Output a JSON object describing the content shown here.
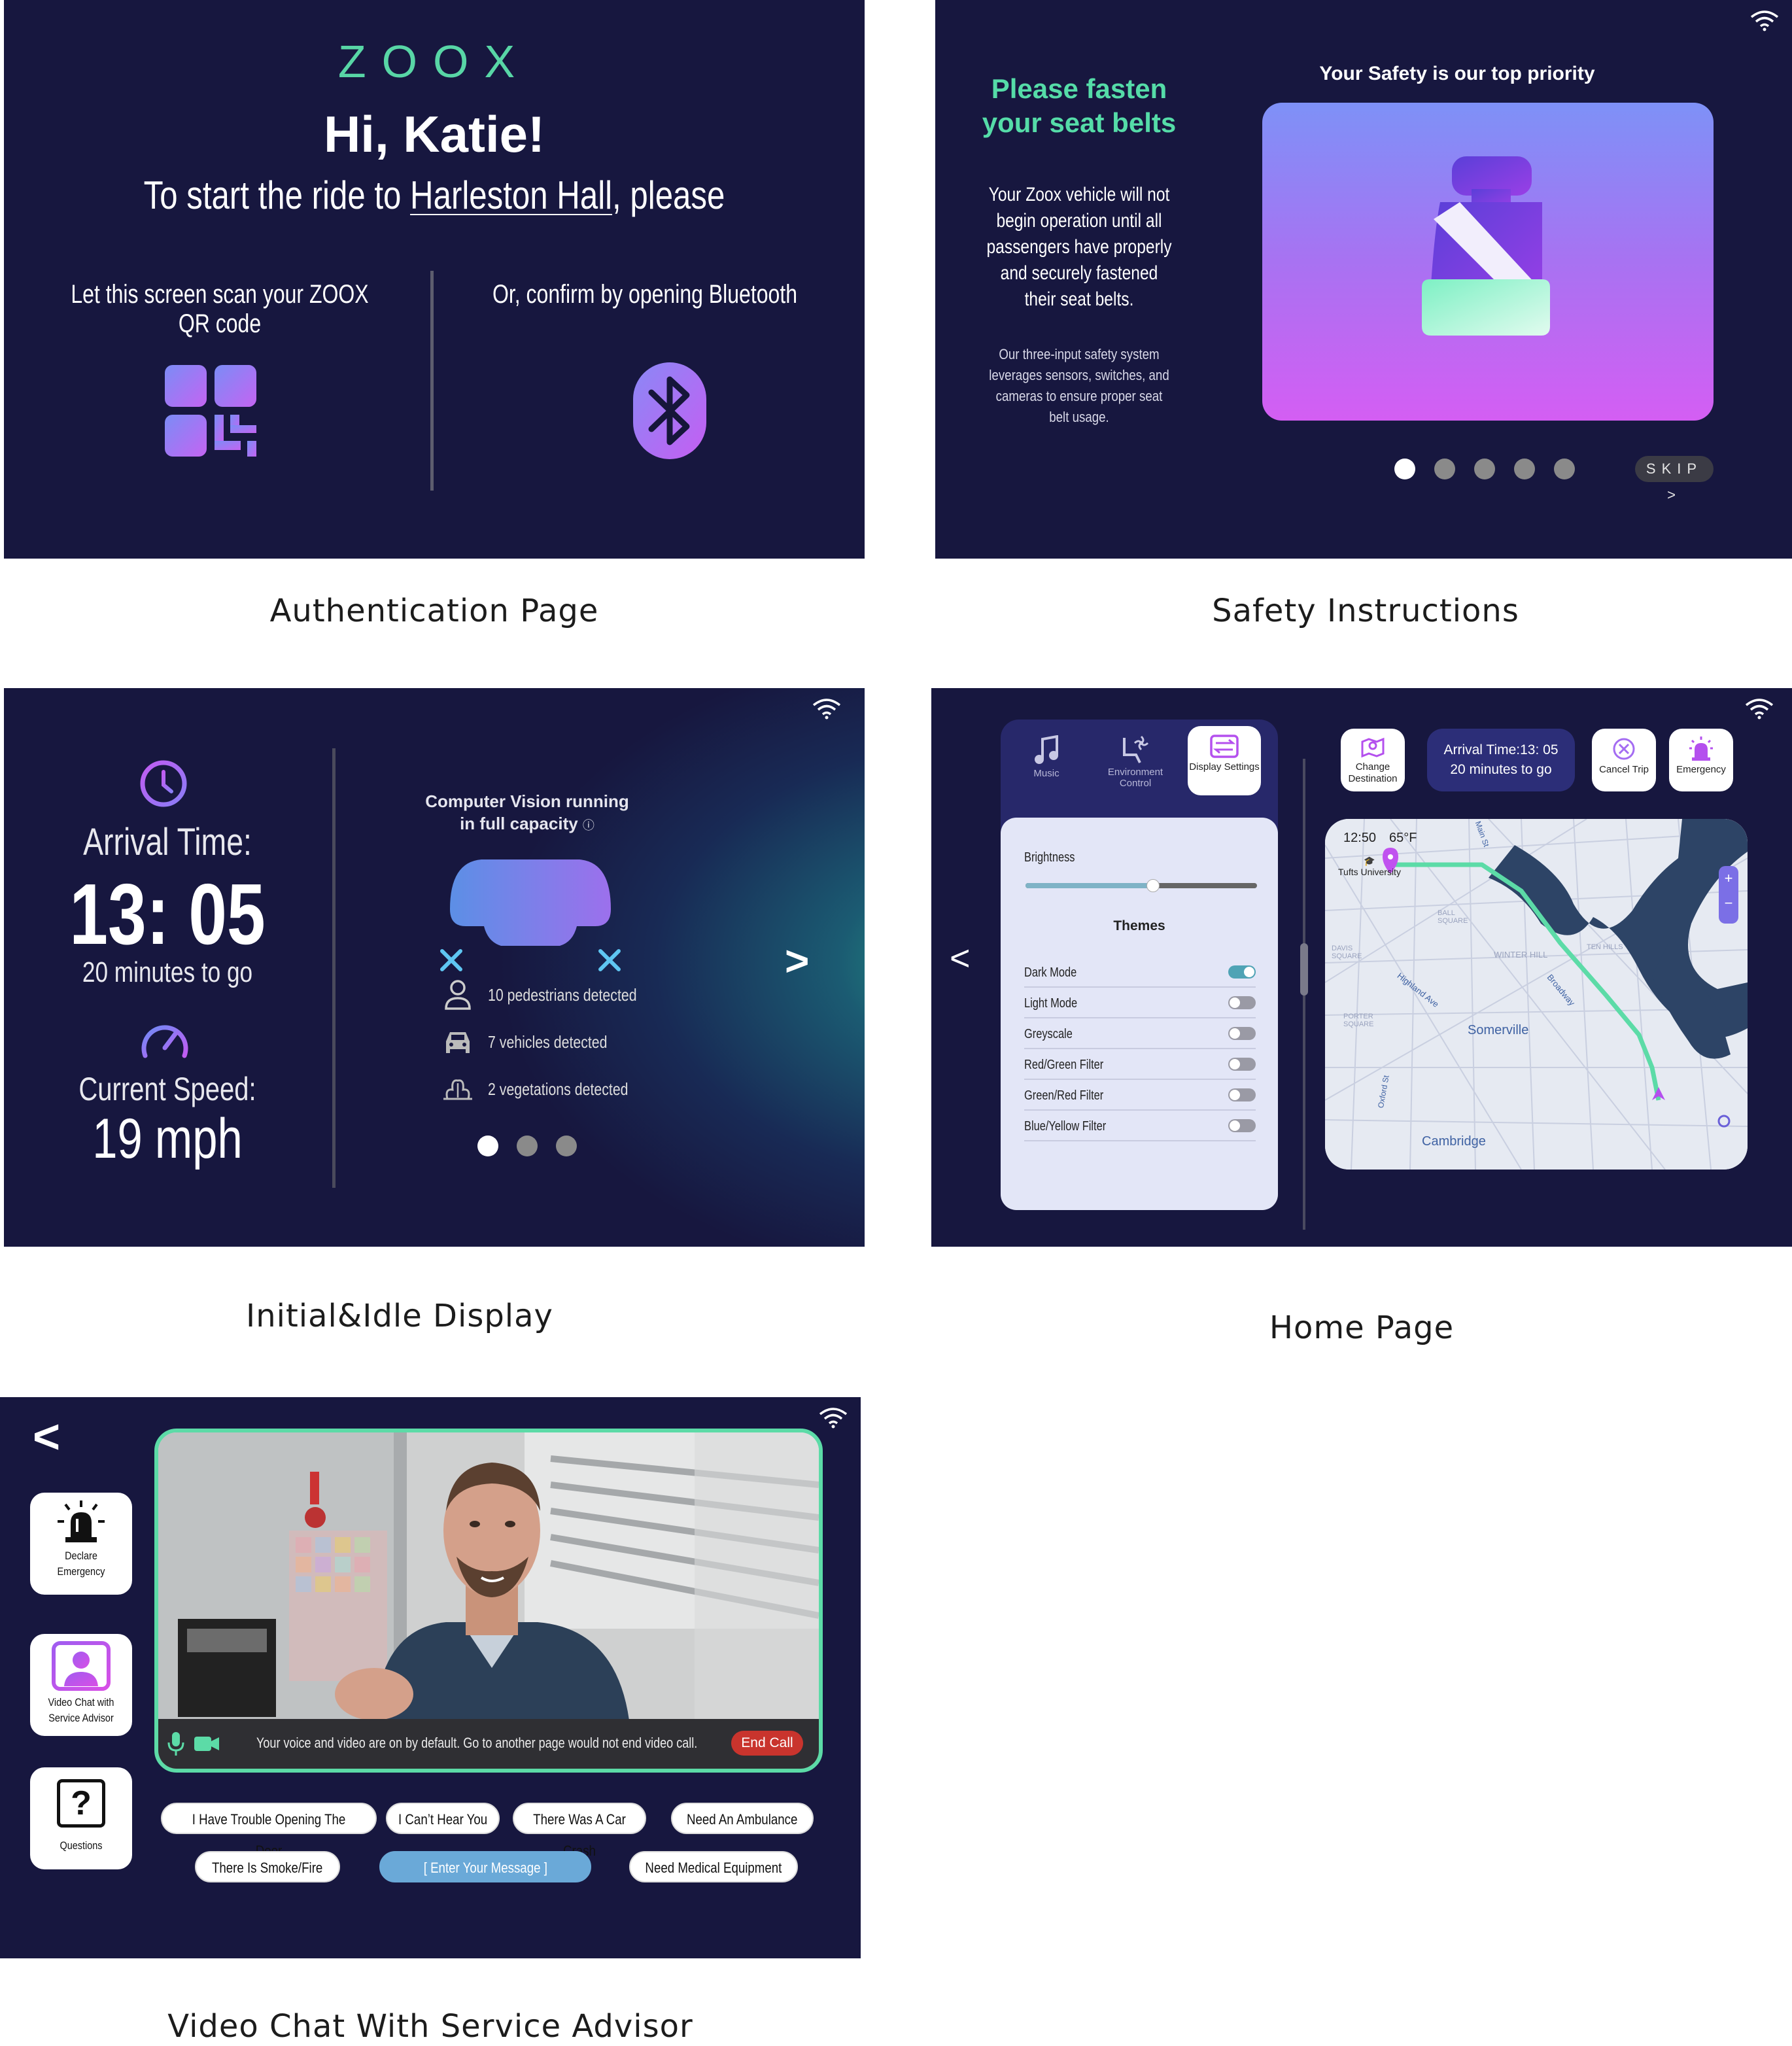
{
  "captions": {
    "authentication": "Authentication Page",
    "safety": "Safety Instructions",
    "idle": "Initial&Idle Display",
    "home": "Home Page",
    "video_chat": "Video Chat With Service Advisor"
  },
  "auth": {
    "logo": "ZOOX",
    "greeting": "Hi, Katie!",
    "start_prefix": "To start the ride to ",
    "destination": "Harleston Hall",
    "start_suffix": ", please",
    "qr_text": "Let this screen scan your ZOOX QR code",
    "bluetooth_text": "Or, confirm by opening Bluetooth",
    "icons": [
      "qr-code-icon",
      "bluetooth-icon"
    ]
  },
  "safety": {
    "heading": "Please fasten your seat belts",
    "body": "Your Zoox vehicle will not begin operation until all passengers have properly and securely fastened their seat belts.",
    "detail": "Our three-input safety system leverages sensors, switches, and cameras to ensure proper seat belt usage.",
    "priority": "Your Safety is our top priority",
    "skip": "SKIP >",
    "page_count": 5,
    "active_page": 1
  },
  "idle": {
    "arrival_label": "Arrival Time:",
    "arrival_time": "13: 05",
    "time_to_go": "20 minutes to go",
    "speed_label": "Current Speed:",
    "speed": "19 mph",
    "cv_status_line1": "Computer Vision running",
    "cv_status_line2": "in full capacity",
    "detections": [
      {
        "icon": "person-icon",
        "text": "10 pedestrians detected"
      },
      {
        "icon": "car-icon",
        "text": "7 vehicles detected"
      },
      {
        "icon": "plant-icon",
        "text": "2 vegetations detected"
      }
    ],
    "next": ">",
    "page_count": 3,
    "active_page": 1
  },
  "home": {
    "back": "<",
    "tabs": [
      {
        "icon": "music-icon",
        "label": "Music"
      },
      {
        "icon": "fan-seat-icon",
        "label": "Environment Control"
      },
      {
        "icon": "display-settings-icon",
        "label": "Display Settings"
      }
    ],
    "brightness_label": "Brightness",
    "brightness_value": 0.55,
    "themes_label": "Themes",
    "themes": [
      {
        "label": "Dark Mode",
        "on": true
      },
      {
        "label": "Light Mode",
        "on": false
      },
      {
        "label": "Greyscale",
        "on": false
      },
      {
        "label": "Red/Green Filter",
        "on": false
      },
      {
        "label": "Green/Red Filter",
        "on": false
      },
      {
        "label": "Blue/Yellow Filter",
        "on": false
      }
    ],
    "change_destination": "Change Destination",
    "arrival_line1": "Arrival Time:13: 05",
    "arrival_line2": "20 minutes to go",
    "cancel_trip": "Cancel Trip",
    "emergency": "Emergency",
    "map": {
      "time": "12:50",
      "temp": "65°F",
      "place": "Tufts University",
      "labels": [
        "Somerville",
        "Cambridge",
        "Broadway",
        "Highland Ave",
        "Winter Hill",
        "Porter Square",
        "Davis Square",
        "Ball Square",
        "Ten Hills",
        "Oxford St",
        "Main St"
      ],
      "zoom_in": "+",
      "zoom_out": "−"
    },
    "page_count": 2,
    "active_page": 1
  },
  "video": {
    "back": "<",
    "side_buttons": [
      {
        "icon": "siren-icon",
        "label": "Declare Emergency"
      },
      {
        "icon": "user-video-icon",
        "label": "Video Chat with Service Advisor"
      },
      {
        "icon": "question-icon",
        "label": "Questions"
      }
    ],
    "status": "Your voice and video are on by default. Go to another page would not end video call.",
    "end_call": "End Call",
    "quick_replies_row1": [
      "I Have Trouble Opening The Door",
      "I Can’t Hear You",
      "There Was A Car Crash",
      "Need An Ambulance"
    ],
    "quick_replies_row2": [
      "There Is Smoke/Fire",
      "[ Enter Your Message ]",
      "Need Medical Equipment"
    ]
  },
  "colors": {
    "panel_bg": "#17173f",
    "accent_green": "#58d6a6",
    "accent_purple": "#a878f4",
    "end_call_red": "#c9342d"
  }
}
